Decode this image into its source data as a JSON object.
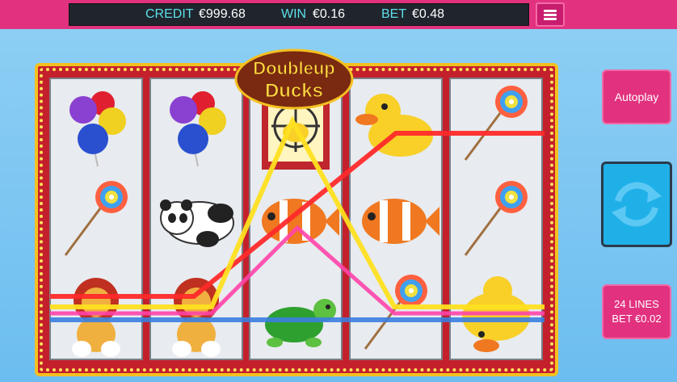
{
  "hud": {
    "credit_label": "CREDIT",
    "credit_value": "€999.68",
    "win_label": "WIN",
    "win_value": "€0.16",
    "bet_label": "BET",
    "bet_value": "€0.48"
  },
  "game": {
    "logo_line1": "Doubleup",
    "logo_line2": "Ducks"
  },
  "buttons": {
    "autoplay_label": "Autoplay",
    "lines_label": "24 LINES",
    "bet_label": "BET €0.02"
  },
  "reels": [
    [
      "balloons",
      "lollipop",
      "lion-plush"
    ],
    [
      "balloons",
      "panda-plush",
      "lion-plush"
    ],
    [
      "duck-target",
      "clownfish",
      "turtle"
    ],
    [
      "rubber-duck",
      "clownfish",
      "lollipop"
    ],
    [
      "lollipop",
      "lollipop",
      "rubber-duck"
    ]
  ],
  "colors": {
    "topbar": "#e2327f",
    "frame": "#c4202c",
    "frame_border": "#f4c020",
    "win_line_red": "#ff2a2a",
    "win_line_yellow": "#ffe020",
    "win_line_pink": "#ff44aa",
    "win_line_blue": "#3a7ee0"
  }
}
